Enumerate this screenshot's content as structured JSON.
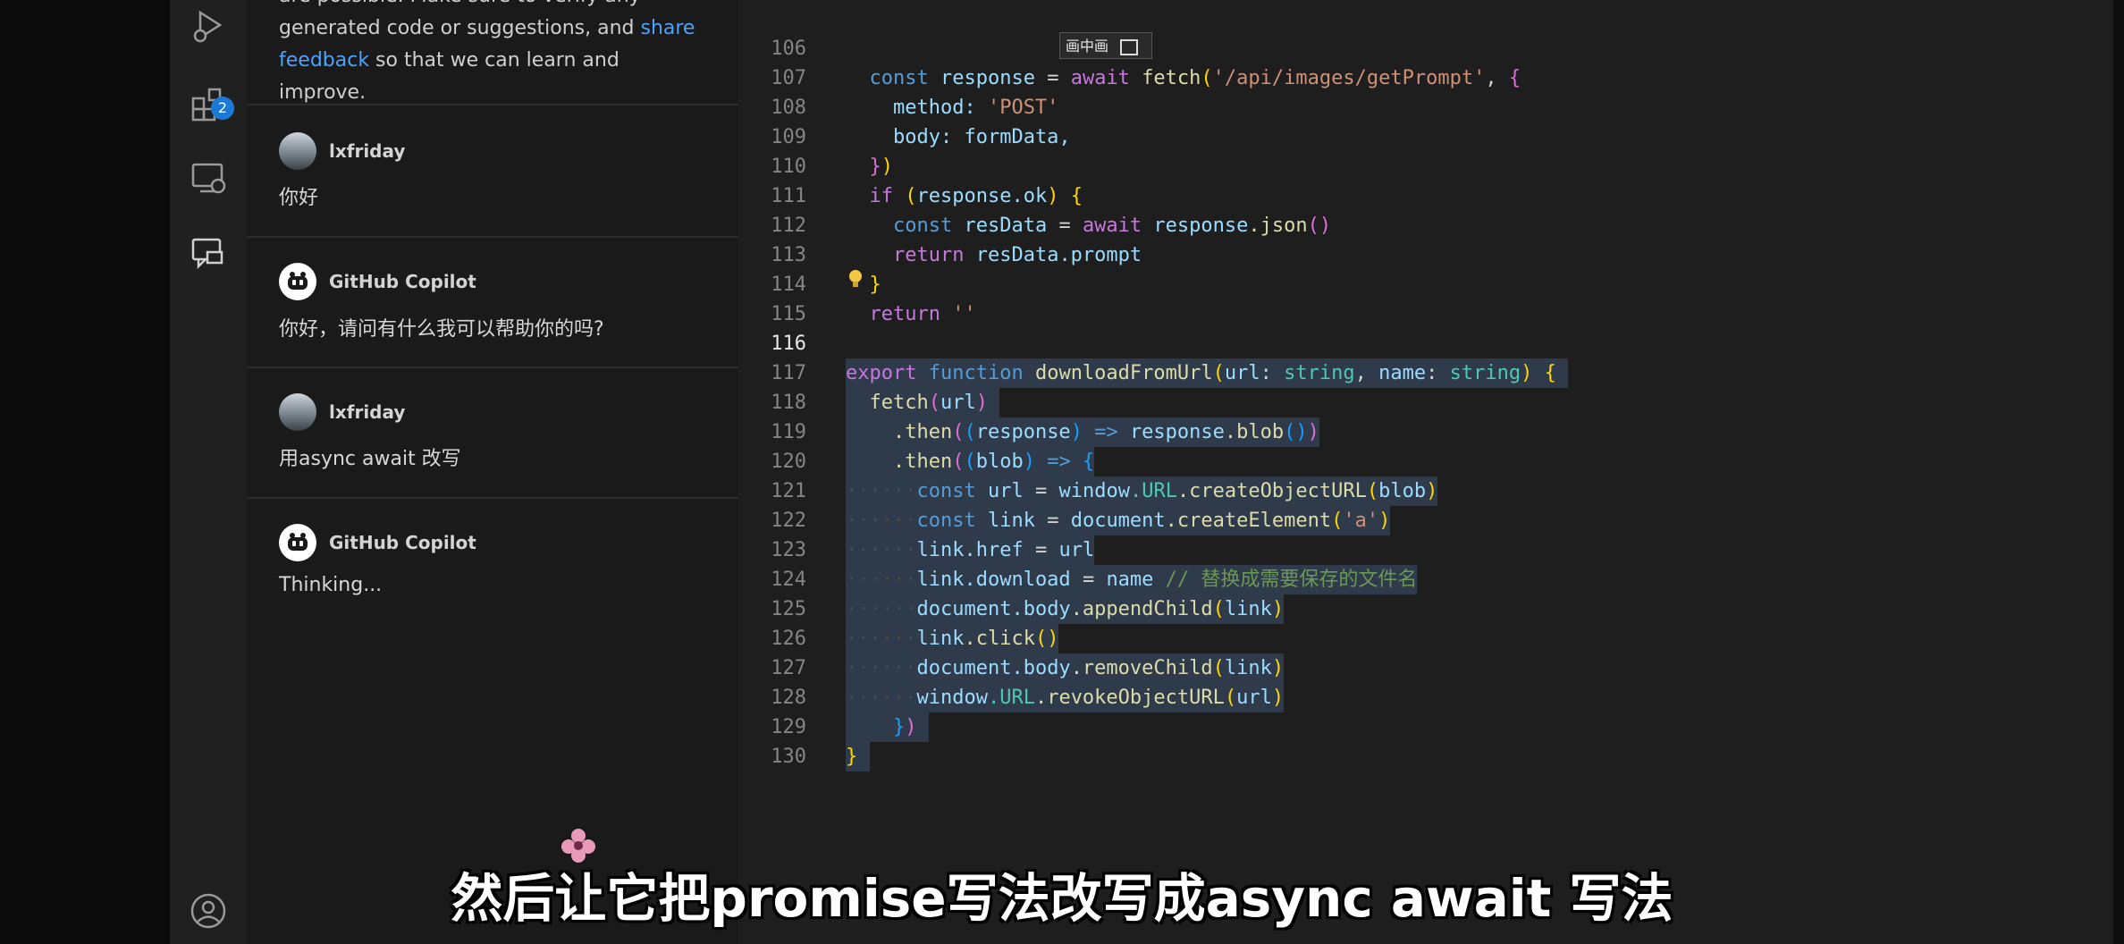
{
  "activity_bar": {
    "icons": [
      "run-debug-icon",
      "extensions-icon",
      "remote-explorer-icon",
      "chat-icon",
      "account-icon"
    ],
    "extensions_badge": "2"
  },
  "chat": {
    "notice": {
      "prefix": "are possible. Make sure to verify any generated code or suggestions, and ",
      "link": "share feedback",
      "suffix": " so that we can learn and improve."
    },
    "messages": [
      {
        "author": "lxfriday",
        "text": "你好"
      },
      {
        "author": "GitHub Copilot",
        "text": "你好，请问有什么我可以帮助你的吗?"
      },
      {
        "author": "lxfriday",
        "text": "用async await 改写"
      },
      {
        "author": "GitHub Copilot",
        "text": "Thinking..."
      }
    ]
  },
  "editor": {
    "ime_popup": "画中画",
    "active_line": 116,
    "lines": [
      {
        "n": "106"
      },
      {
        "n": "107"
      },
      {
        "n": "108"
      },
      {
        "n": "109"
      },
      {
        "n": "110"
      },
      {
        "n": "111"
      },
      {
        "n": "112"
      },
      {
        "n": "113"
      },
      {
        "n": "114"
      },
      {
        "n": "115"
      },
      {
        "n": "116"
      },
      {
        "n": "117"
      },
      {
        "n": "118"
      },
      {
        "n": "119"
      },
      {
        "n": "120"
      },
      {
        "n": "121"
      },
      {
        "n": "122"
      },
      {
        "n": "123"
      },
      {
        "n": "124"
      },
      {
        "n": "125"
      },
      {
        "n": "126"
      },
      {
        "n": "127"
      },
      {
        "n": "128"
      },
      {
        "n": "129"
      },
      {
        "n": "130"
      }
    ],
    "code": {
      "l106": [
        "const",
        "response",
        "=",
        "await",
        "fetch",
        "'/api/images/getPrompt'"
      ],
      "l107": [
        "method:",
        "'POST'"
      ],
      "l108": [
        "body:",
        "formData,"
      ],
      "l110": [
        "if",
        "response",
        ".ok"
      ],
      "l111": [
        "const",
        "resData",
        "=",
        "await",
        "response",
        ".json"
      ],
      "l112": [
        "return",
        "resData",
        ".prompt"
      ],
      "l114": [
        "return",
        "''"
      ],
      "l116": [
        "export",
        "function",
        "downloadFromUrl",
        "url",
        "string",
        "name",
        "string"
      ],
      "l117": [
        "fetch",
        "url"
      ],
      "l118": [
        ".then",
        "response",
        "=>",
        "response",
        ".blob"
      ],
      "l119": [
        ".then",
        "blob",
        "=>"
      ],
      "l120": [
        "const",
        "url",
        "=",
        "window",
        ".URL",
        ".createObjectURL",
        "blob"
      ],
      "l121": [
        "const",
        "link",
        "=",
        "document",
        ".createElement",
        "'a'"
      ],
      "l122": [
        "link",
        ".href",
        "=",
        "url"
      ],
      "l123": [
        "link",
        ".download",
        "=",
        "name",
        "// 替换成需要保存的文件名"
      ],
      "l124": [
        "document",
        ".body",
        ".appendChild",
        "link"
      ],
      "l125": [
        "link",
        ".click"
      ],
      "l126": [
        "document",
        ".body",
        ".removeChild",
        "link"
      ],
      "l127": [
        "window",
        ".URL",
        ".revokeObjectURL",
        "url"
      ]
    }
  },
  "subtitle": "然后让它把promise写法改写成async await 写法",
  "colors": {
    "accent": "#1c7ad6",
    "link": "#4aa3ff",
    "selection": "#2f3a4a"
  }
}
